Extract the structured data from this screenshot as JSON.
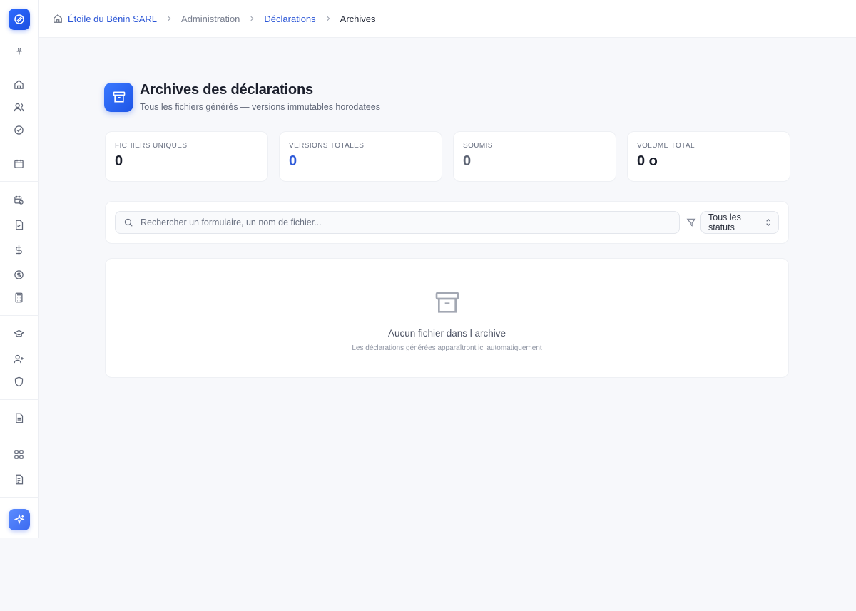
{
  "breadcrumb": {
    "company": "Étoile du Bénin SARL",
    "section": "Administration",
    "subsection": "Déclarations",
    "current": "Archives"
  },
  "sidebar": {
    "items": [
      {
        "name": "home-icon"
      },
      {
        "name": "users-icon"
      },
      {
        "name": "check-circle-icon"
      },
      {
        "name": "calendar-icon"
      },
      {
        "name": "calendar-clock-icon"
      },
      {
        "name": "file-check-icon"
      },
      {
        "name": "dollar-icon"
      },
      {
        "name": "dollar-circle-icon"
      },
      {
        "name": "calculator-icon"
      },
      {
        "name": "graduation-cap-icon"
      },
      {
        "name": "user-plus-icon"
      },
      {
        "name": "shield-icon"
      },
      {
        "name": "document-icon"
      },
      {
        "name": "grid-icon"
      },
      {
        "name": "file-text-icon"
      }
    ]
  },
  "page": {
    "title": "Archives des déclarations",
    "subtitle": "Tous les fichiers générés — versions immutables horodatees"
  },
  "stats": [
    {
      "label": "FICHIERS UNIQUES",
      "value": "0"
    },
    {
      "label": "VERSIONS TOTALES",
      "value": "0"
    },
    {
      "label": "SOUMIS",
      "value": "0"
    },
    {
      "label": "VOLUME TOTAL",
      "value": "0 o"
    }
  ],
  "filters": {
    "search_placeholder": "Rechercher un formulaire, un nom de fichier...",
    "status_selected": "Tous les statuts"
  },
  "empty": {
    "title": "Aucun fichier dans l archive",
    "subtitle": "Les déclarations générées apparaîtront ici automatiquement"
  },
  "colors": {
    "accent": "#2a55d6",
    "brand_gradient_start": "#2f6bff",
    "brand_gradient_end": "#1b4fe0"
  }
}
